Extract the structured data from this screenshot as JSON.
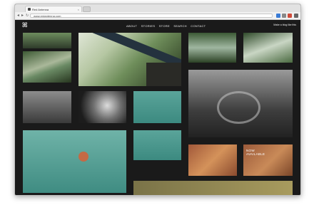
{
  "browser": {
    "tab_title": "Red Antenna",
    "tab_close": "×",
    "url": "www.redantenna.com",
    "nav_back": "◂",
    "nav_forward": "▸",
    "nav_reload": "↻"
  },
  "site": {
    "logo": "ꕤ",
    "nav": [
      "ABOUT",
      "STORIES",
      "STORE",
      "SEARCH",
      "CONTACT"
    ],
    "corner_text": "Make a blog like this",
    "avail_text_1": "NOW",
    "avail_text_2": "AVAILABLE"
  }
}
